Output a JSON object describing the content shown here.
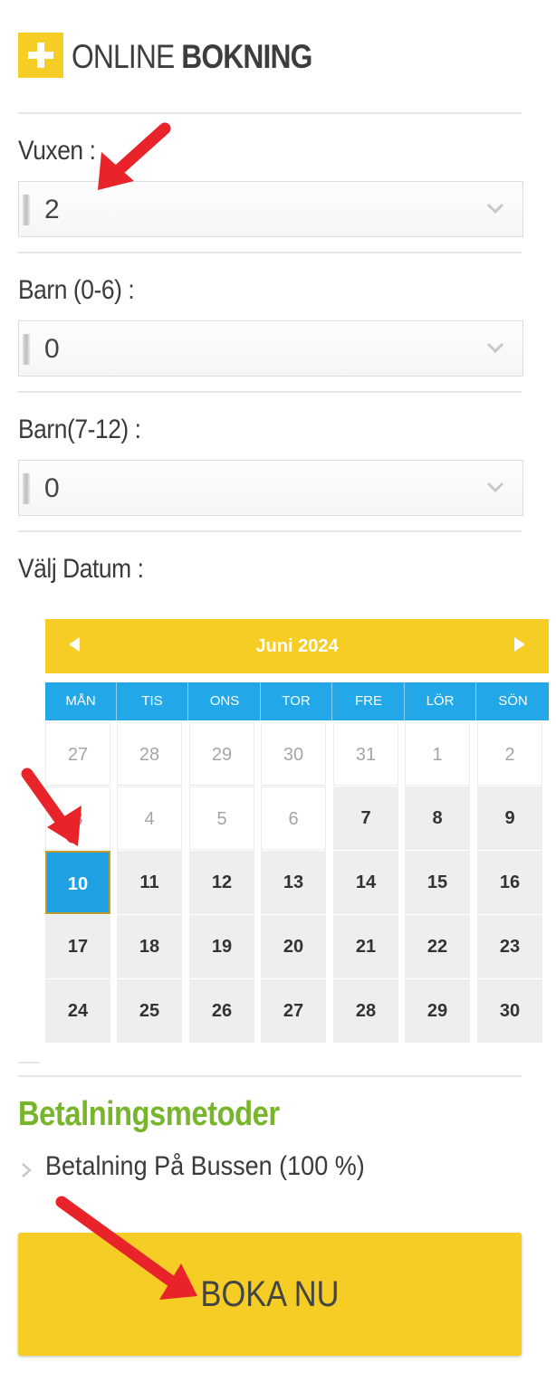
{
  "header": {
    "title_light": "ONLINE",
    "title_bold": "BOKNING",
    "brand_color": "#f5cd25"
  },
  "form": {
    "adults": {
      "label": "Vuxen :",
      "value": "2"
    },
    "kids_0_6": {
      "label": "Barn (0-6) :",
      "value": "0"
    },
    "kids_7_12": {
      "label": "Barn(7-12) :",
      "value": "0"
    },
    "date_label": "Välj Datum :"
  },
  "calendar": {
    "month": "Juni 2024",
    "weekdays": [
      "MÅN",
      "TIS",
      "ONS",
      "TOR",
      "FRE",
      "LÖR",
      "SÖN"
    ],
    "weeks": [
      [
        "27",
        "28",
        "29",
        "30",
        "31",
        "1",
        "2"
      ],
      [
        "3",
        "4",
        "5",
        "6",
        "7",
        "8",
        "9"
      ],
      [
        "10",
        "11",
        "12",
        "13",
        "14",
        "15",
        "16"
      ],
      [
        "17",
        "18",
        "19",
        "20",
        "21",
        "22",
        "23"
      ],
      [
        "24",
        "25",
        "26",
        "27",
        "28",
        "29",
        "30"
      ]
    ],
    "disabled": [
      [
        true,
        true,
        true,
        true,
        true,
        true,
        true
      ],
      [
        true,
        true,
        true,
        true,
        false,
        false,
        false
      ],
      [
        false,
        false,
        false,
        false,
        false,
        false,
        false
      ],
      [
        false,
        false,
        false,
        false,
        false,
        false,
        false
      ],
      [
        false,
        false,
        false,
        false,
        false,
        false,
        false
      ]
    ],
    "selected": "10",
    "header_color": "#f5cd25",
    "weekday_color": "#22a8e8"
  },
  "payment": {
    "title": "Betalningsmetoder",
    "title_color": "#77b52a",
    "method": "Betalning På Bussen (100 %)"
  },
  "book_button": {
    "label": "BOKA NU"
  },
  "annotation_color": "#e8232a"
}
